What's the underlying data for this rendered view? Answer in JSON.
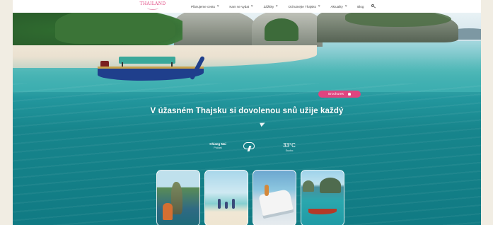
{
  "brand": {
    "logo_text": "THAILAND"
  },
  "nav": {
    "items": [
      {
        "label": "Plánujeme cestu",
        "dropdown": true
      },
      {
        "label": "Kam se vydat",
        "dropdown": true
      },
      {
        "label": "Zážitky",
        "dropdown": true
      },
      {
        "label": "Ochutnejte Thajsko",
        "dropdown": true
      },
      {
        "label": "Aktuality",
        "dropdown": true
      },
      {
        "label": "Blog",
        "dropdown": false
      }
    ],
    "search_icon": "search-icon"
  },
  "hero": {
    "badge_label": "Brochures",
    "headline": "V úžasném Thajsku si dovolenou snů užije každý",
    "weather": {
      "city": "Chiang Mai",
      "condition": "Počasí",
      "icon": "cloud-lightning-icon",
      "temperature": "33°C",
      "temperature_sub": "Sucho"
    }
  },
  "cards": [
    {
      "icon": "james-bond-island-photo"
    },
    {
      "icon": "family-beach-photo"
    },
    {
      "icon": "yacht-photo"
    },
    {
      "icon": "longtail-boat-photo"
    }
  ],
  "colors": {
    "accent": "#e0447f",
    "sea": "#107a83",
    "header": "#ffffff"
  }
}
